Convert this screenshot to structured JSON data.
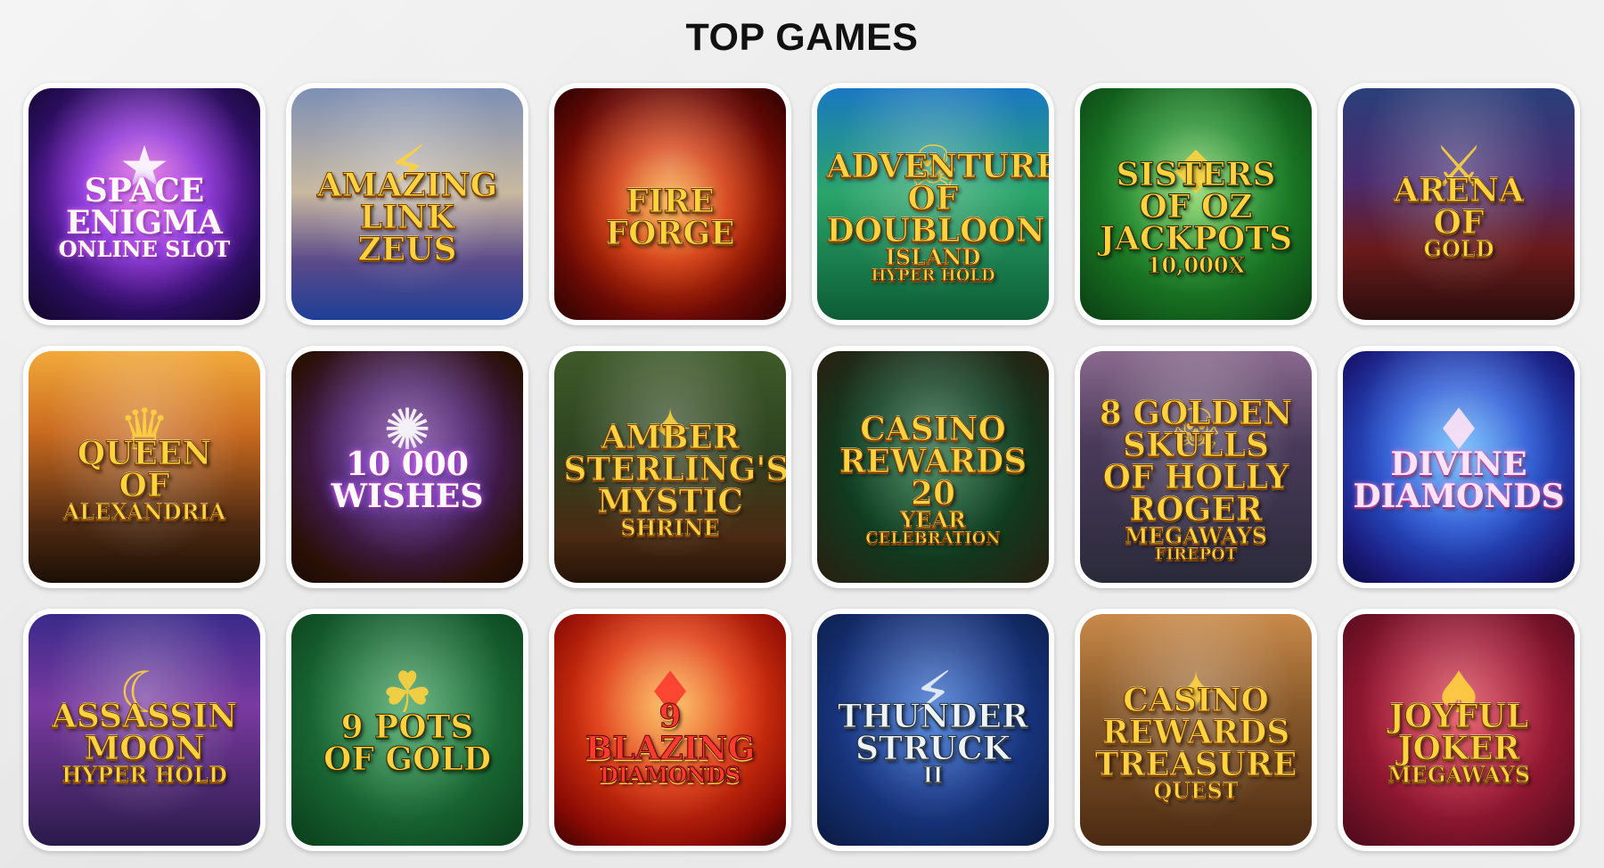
{
  "page": {
    "title": "TOP GAMES"
  },
  "games": [
    {
      "lines": [
        "SPACE",
        "ENIGMA",
        "ONLINE SLOT"
      ],
      "bg": "radial-gradient(circle at 50% 45%, #ff6bd8 0%, #8b2bd6 35%, #2a0e5e 70%, #120526 100%)",
      "accent": "#ffffff",
      "style": "white",
      "icon": "star-icon",
      "deco": "★"
    },
    {
      "lines": [
        "AMAZING LINK",
        "ZEUS"
      ],
      "bg": "linear-gradient(180deg, #7d8fb5 0%, #c9b9a0 45%, #5a4a8a 75%, #1e3f96 100%)",
      "accent": "#ffd23f",
      "style": "gold",
      "icon": "zeus-icon",
      "deco": "⚡"
    },
    {
      "lines": [
        "FIRE",
        "FORGE"
      ],
      "bg": "radial-gradient(circle at 50% 50%, #ffb13b 0%, #d2380b 35%, #6b0a05 70%, #2a0200 100%)",
      "accent": "#ffd23f",
      "style": "gold",
      "icon": "flame-icon",
      "deco": ""
    },
    {
      "lines": [
        "ADVENTURES OF",
        "DOUBLOON",
        "ISLAND",
        "HYPER HOLD"
      ],
      "bg": "linear-gradient(180deg, #1a78c2 0%, #2aa56a 45%, #0d5c35 100%)",
      "accent": "#ffd23f",
      "style": "gold",
      "icon": "skull-icon",
      "deco": "☠"
    },
    {
      "lines": [
        "SISTERS OF OZ",
        "JACKPOTS",
        "10,000X"
      ],
      "bg": "radial-gradient(circle at 50% 45%, #7fd35a 0%, #1f8a2a 40%, #0a3d12 100%)",
      "accent": "#ffd23f",
      "style": "green",
      "icon": "emerald-icon",
      "deco": "◆"
    },
    {
      "lines": [
        "ARENA",
        "OF",
        "GOLD"
      ],
      "bg": "linear-gradient(180deg, #2b3f7a 0%, #4a2b6e 40%, #6a1a1a 70%, #2a0d0d 100%)",
      "accent": "#ffd23f",
      "style": "gold",
      "icon": "warrior-icon",
      "deco": "⚔"
    },
    {
      "lines": [
        "QUEEN",
        "OF",
        "ALEXANDRIA"
      ],
      "bg": "linear-gradient(180deg, #f2a93a 0%, #c96a1f 35%, #4e2a12 75%, #1c0f05 100%)",
      "accent": "#ffd23f",
      "style": "gold",
      "icon": "queen-icon",
      "deco": "♛"
    },
    {
      "lines": [
        "10 000",
        "WISHES"
      ],
      "bg": "radial-gradient(circle at 50% 45%, #7a3aa0 0%, #4a1f6a 40%, #2a1007 80%, #1a0a04 100%)",
      "accent": "#ffffff",
      "style": "white",
      "icon": "wheel-icon",
      "deco": "✺"
    },
    {
      "lines": [
        "AMBER STERLING'S",
        "MYSTIC",
        "SHRINE"
      ],
      "bg": "linear-gradient(180deg, #3f5a2a 0%, #2e4420 40%, #4a2a12 80%, #241308 100%)",
      "accent": "#ffd23f",
      "style": "gold",
      "icon": "explorer-icon",
      "deco": "✦"
    },
    {
      "lines": [
        "CASINO REWARDS",
        "20",
        "YEAR",
        "CELEBRATION"
      ],
      "bg": "radial-gradient(circle at 50% 50%, #1f6a3a 0%, #0e3d20 50%, #2a1e10 100%)",
      "accent": "#ffd23f",
      "style": "gold",
      "icon": "trophy-icon",
      "deco": ""
    },
    {
      "lines": [
        "8 GOLDEN SKULLS",
        "OF HOLLY ROGER",
        "MEGAWAYS",
        "FIREPOT"
      ],
      "bg": "linear-gradient(180deg, #8a6a8e 0%, #4a3a5a 40%, #2a2a3a 100%)",
      "accent": "#ffd23f",
      "style": "gold",
      "icon": "skull-icon",
      "deco": "☠"
    },
    {
      "lines": [
        "DIVINE",
        "DIAMONDS"
      ],
      "bg": "radial-gradient(circle at 50% 45%, #5ab8ff 0%, #2a5ad6 40%, #1a1a7a 80%, #0a0a40 100%)",
      "accent": "#ffe3f6",
      "style": "pink",
      "icon": "diamond-icon",
      "deco": "♦"
    },
    {
      "lines": [
        "ASSASSIN",
        "MOON",
        "HYPER HOLD"
      ],
      "bg": "linear-gradient(180deg, #3a2a8a 0%, #7a3aa0 40%, #2a1a4a 100%)",
      "accent": "#ffd23f",
      "style": "gold",
      "icon": "moon-icon",
      "deco": "☾"
    },
    {
      "lines": [
        "9 POTS",
        "OF GOLD"
      ],
      "bg": "radial-gradient(circle at 50% 45%, #3aa05a 0%, #1a6a35 50%, #0a3d1a 100%)",
      "accent": "#ffd23f",
      "style": "green",
      "icon": "pot-icon",
      "deco": "☘"
    },
    {
      "lines": [
        "9",
        "BLAZING",
        "DIAMONDS"
      ],
      "bg": "radial-gradient(circle at 50% 40%, #ffb13b 0%, #e03a10 40%, #8a0a05 80%, #3a0200 100%)",
      "accent": "#ff3b2e",
      "style": "red",
      "icon": "diamond-icon",
      "deco": "♦"
    },
    {
      "lines": [
        "THUNDER",
        "STRUCK",
        "II"
      ],
      "bg": "radial-gradient(circle at 50% 45%, #2a6ad6 0%, #1a3a8a 45%, #0a1a40 100%)",
      "accent": "#eef3f8",
      "style": "silver",
      "icon": "thunder-icon",
      "deco": "⚡"
    },
    {
      "lines": [
        "CASINO REWARDS",
        "TREASURE",
        "QUEST"
      ],
      "bg": "linear-gradient(180deg, #c98a4a 0%, #8a5a2a 40%, #4a2a12 100%)",
      "accent": "#ffd23f",
      "style": "gold",
      "icon": "compass-icon",
      "deco": "✦"
    },
    {
      "lines": [
        "JOYFUL",
        "JOKER",
        "MEGAWAYS"
      ],
      "bg": "radial-gradient(circle at 50% 45%, #e03a4a 0%, #a01a35 45%, #4a0a1a 100%)",
      "accent": "#ffd23f",
      "style": "gold",
      "icon": "jester-icon",
      "deco": "♠"
    }
  ]
}
